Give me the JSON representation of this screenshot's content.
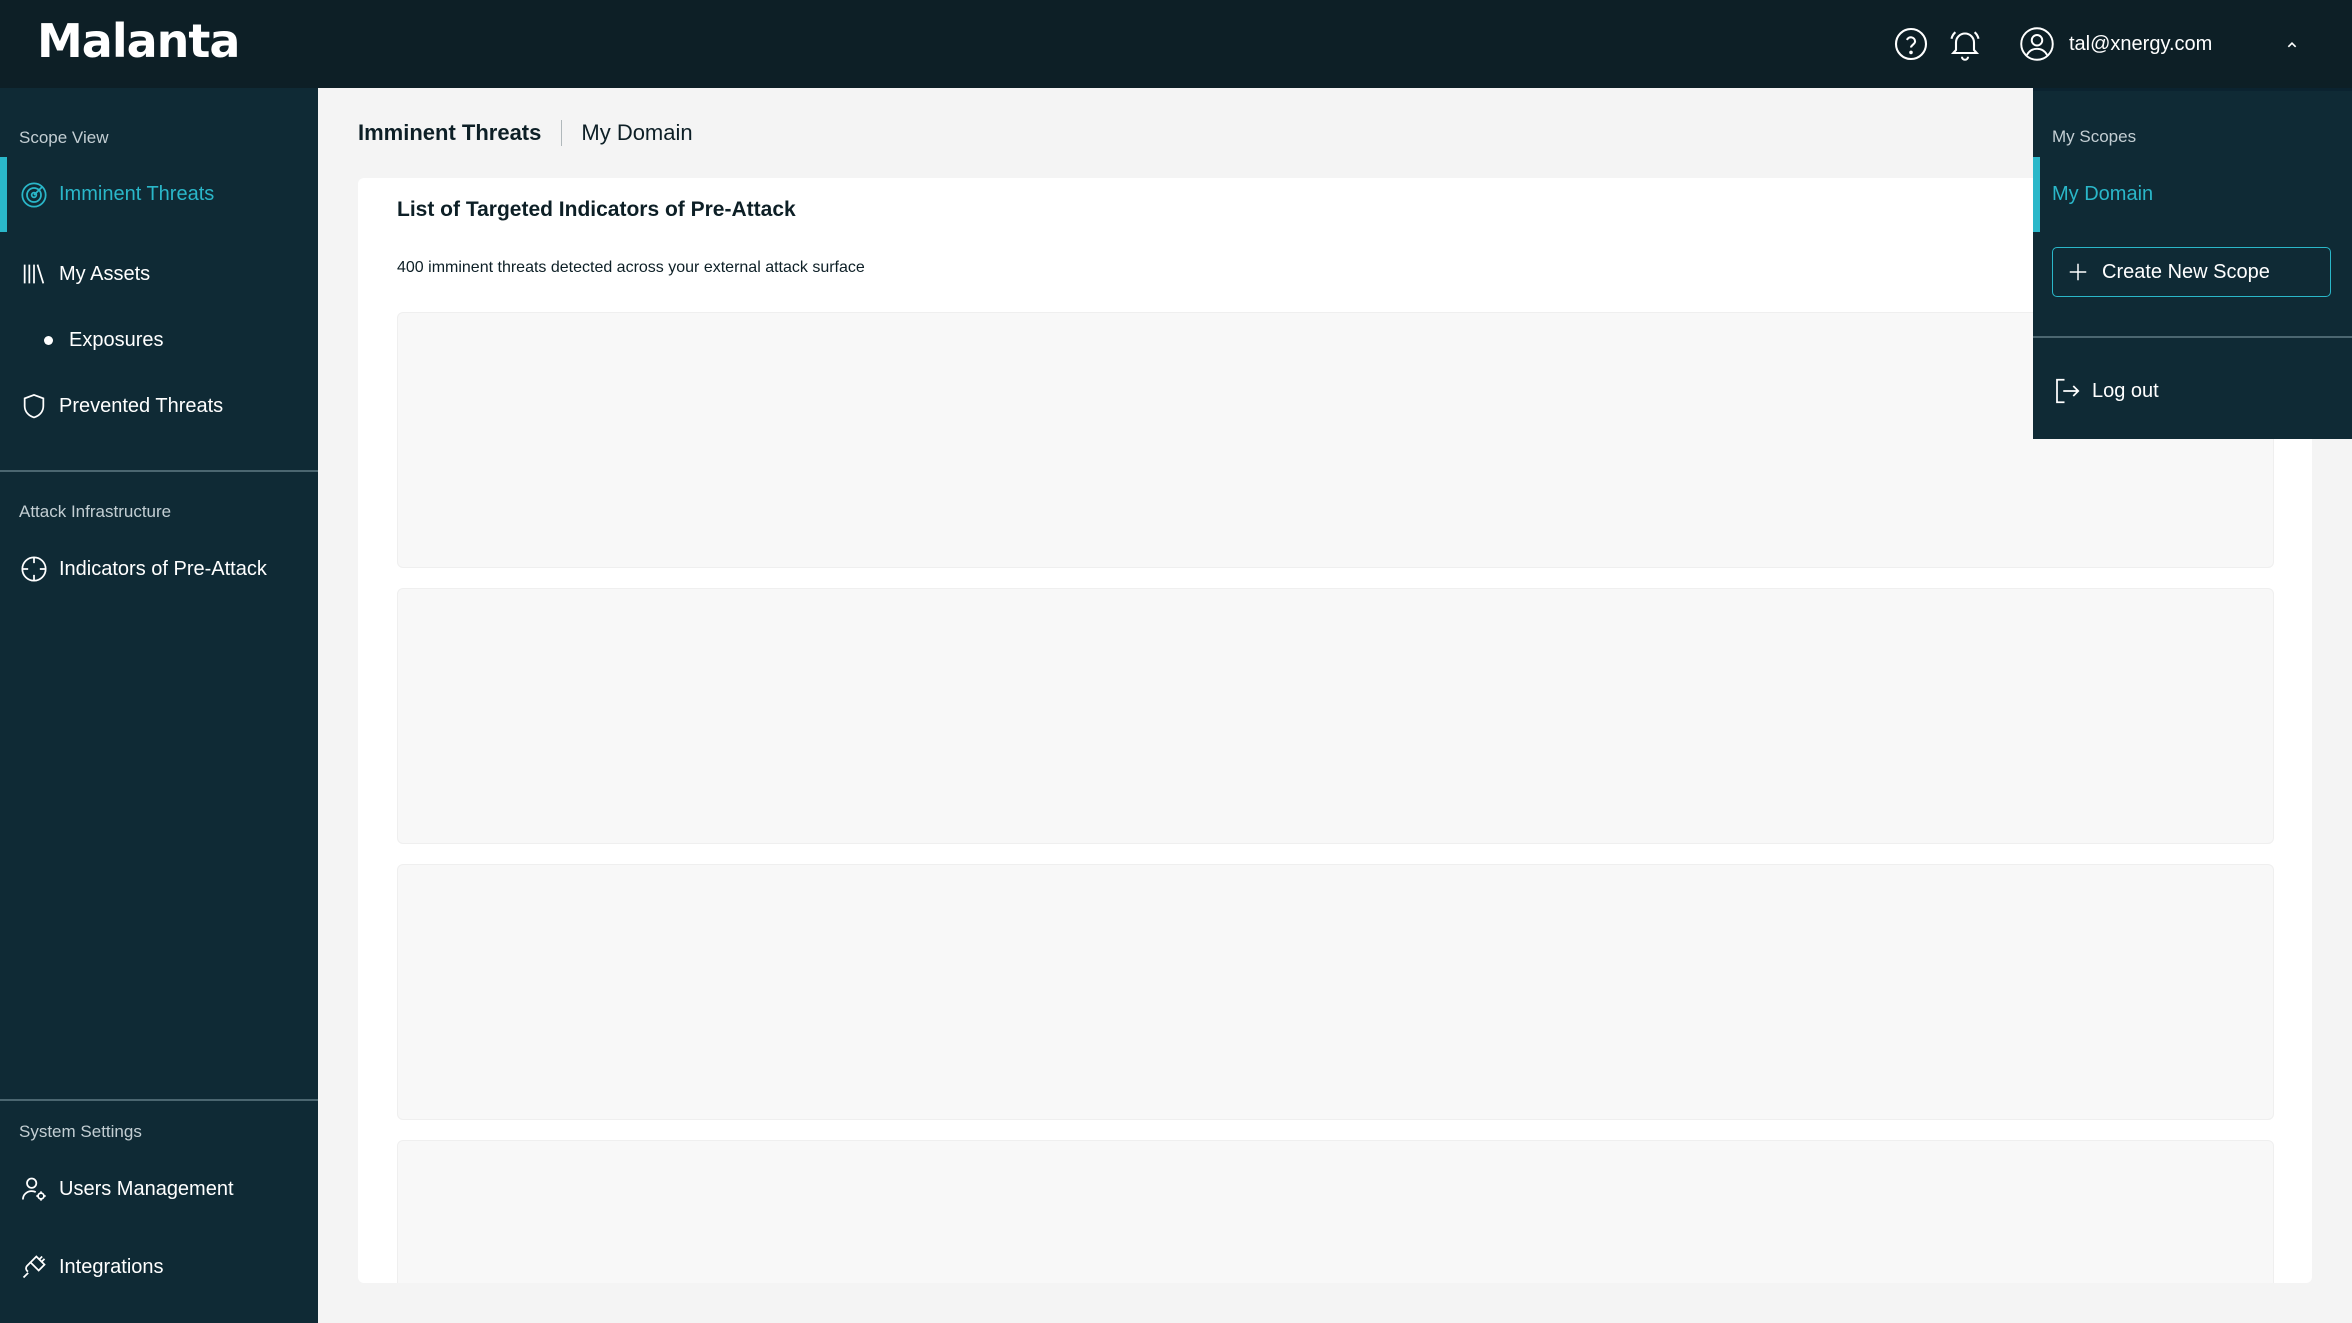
{
  "app": {
    "logo": "Malanta"
  },
  "header": {
    "help_icon": "question-circle-icon",
    "notifications_icon": "bell-icon",
    "user_icon": "user-circle-icon",
    "user_email": "tal@xnergy.com",
    "menu_icon": "chevron-up-icon"
  },
  "sidebar": {
    "sections": {
      "scope_view": "Scope View",
      "attack_infrastructure": "Attack Infrastructure",
      "system_settings": "System Settings"
    },
    "items": {
      "imminent_threats": "Imminent Threats",
      "my_assets": "My Assets",
      "exposures": "Exposures",
      "prevented_threats": "Prevented Threats",
      "indicators": "Indicators of Pre-Attack",
      "users_management": "Users Management",
      "integrations": "Integrations"
    },
    "active_item": "Imminent Threats"
  },
  "breadcrumb": {
    "page": "Imminent Threats",
    "scope": "My Domain"
  },
  "main": {
    "card_title": "List of Targeted Indicators of Pre-Attack",
    "card_subtitle": "400 imminent threats detected across your external attack surface",
    "loading_placeholders": 4
  },
  "dropdown": {
    "label": "My Scopes",
    "selected_scope": "My Domain",
    "create_label": "Create New Scope",
    "logout_label": "Log out"
  },
  "colors": {
    "topbar": "#0d1f26",
    "sidebar": "#0f2a35",
    "accent": "#2ab7c9",
    "background": "#f4f4f4"
  }
}
